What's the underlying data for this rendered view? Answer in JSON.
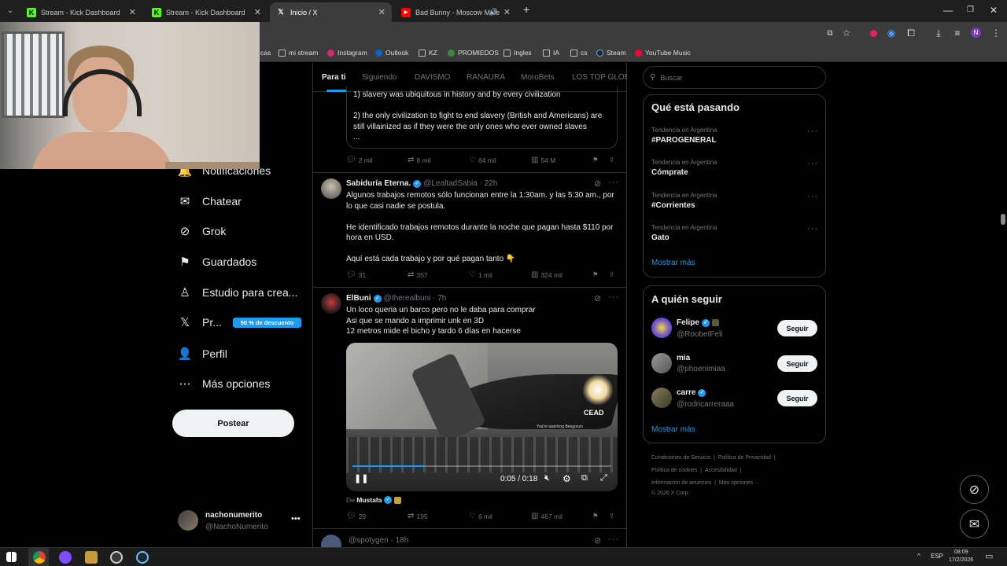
{
  "browser": {
    "tabs": [
      {
        "label": "Stream - Kick Dashboard"
      },
      {
        "label": "Stream - Kick Dashboard"
      },
      {
        "label": "Inicio / X"
      },
      {
        "label": "Bad Bunny - Moscow Mule"
      }
    ],
    "bookmarks": [
      "cas",
      "mi stream",
      "Instagram",
      "Outlook",
      "KZ",
      "PROMIEDOS",
      "Ingles",
      "IA",
      "cs",
      "Steam",
      "YouTube Music"
    ],
    "profile_initial": "N"
  },
  "nav": {
    "items": [
      {
        "label": "Notificaciones",
        "icon": "bell-icon"
      },
      {
        "label": "Chatear",
        "icon": "mail-icon"
      },
      {
        "label": "Grok",
        "icon": "grok-icon"
      },
      {
        "label": "Guardados",
        "icon": "bookmark-icon"
      },
      {
        "label": "Estudio para crea...",
        "icon": "studio-icon"
      },
      {
        "label": "Pr...",
        "icon": "x-logo-icon"
      },
      {
        "label": "Perfil",
        "icon": "person-icon"
      },
      {
        "label": "Más opciones",
        "icon": "more-circle-icon"
      }
    ],
    "promo_badge": "50 % de descuento",
    "post_button": "Postear",
    "account": {
      "name": "nachonumerito",
      "handle": "@NachoNumerito"
    }
  },
  "feed": {
    "tabs": [
      "Para ti",
      "Siguiendo",
      "DAVISMO",
      "RANAURA",
      "MoroBets",
      "LOS TOP GLOBA"
    ],
    "tweet0": {
      "lines": [
        "1) slavery was ubiquitous in history and by every civilization",
        "",
        "2) the only civilization to fight to end slavery (British and Americans) are",
        "still villainized as if they were the only ones who ever owned slaves",
        "..."
      ],
      "replies": "2 mil",
      "reposts": "8 mil",
      "likes": "64 mil",
      "views": "54 M"
    },
    "tweet1": {
      "name": "Sabiduría Eterna.",
      "handle": "@LealtadSabia · 22h",
      "text": "Algunos trabajos remotos sólo funcionan entre la 1:30am. y las 5:30 am., por\nlo que casi nadie se postula.\n\nHe identificado trabajos remotos durante la noche que pagan hasta $110 por\nhora en USD.\n\nAquí está cada trabajo y por qué pagan tanto 👇",
      "replies": "31",
      "reposts": "357",
      "likes": "1 mil",
      "views": "324 mil"
    },
    "tweet2": {
      "name": "ElBuni",
      "handle": "@therealbuni · 7h",
      "text": "Un loco queria un barco pero no le daba para comprar\nAsi que se mando a imprimir unk en 3D\n12 metros mide el bicho y tardo 6 días en hacerse",
      "video_time": "0:05 / 0:18",
      "video_watermark": "CEAD",
      "video_caption": "You're watching Bengonzo",
      "from_label": "De",
      "from_name": "Mustafa",
      "replies": "29",
      "reposts": "195",
      "likes": "6 mil",
      "views": "467 mil"
    },
    "tweet3": {
      "handle": "@spotygen · 18h"
    }
  },
  "sidebar": {
    "search_placeholder": "Buscar",
    "trends_title": "Qué está pasando",
    "trends": [
      {
        "meta": "Tendencia en Argentina",
        "name": "#PAROGENERAL"
      },
      {
        "meta": "Tendencia en Argentina",
        "name": "Cómprate"
      },
      {
        "meta": "Tendencia en Argentina",
        "name": "#Corrientes"
      },
      {
        "meta": "Tendencia en Argentina",
        "name": "Gato"
      }
    ],
    "show_more": "Mostrar más",
    "follow_title": "A quién seguir",
    "follow": [
      {
        "name": "Felipe",
        "handle": "@RoobetFeli"
      },
      {
        "name": "mia",
        "handle": "@phoenimiaa"
      },
      {
        "name": "carre",
        "handle": "@rodricarreraaa"
      }
    ],
    "follow_button": "Seguir",
    "show_more_follow": "Mostrar más",
    "footer": [
      "Condiciones de Servicio",
      "Política de Privacidad",
      "Política de cookies",
      "Accesibilidad",
      "Información de anuncios",
      "Más opciones ···",
      "© 2026 X Corp."
    ]
  },
  "taskbar": {
    "lang": "ESP",
    "time": "08:09",
    "date": "17/2/2026"
  }
}
